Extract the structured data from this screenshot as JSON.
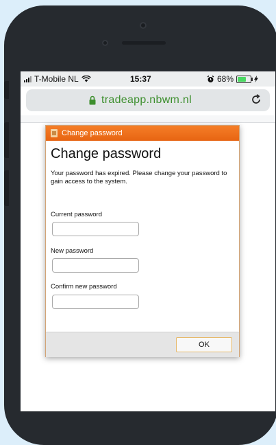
{
  "status_bar": {
    "carrier": "T-Mobile NL",
    "time": "15:37",
    "battery_percent": "68%",
    "battery_level": 0.68,
    "battery_color": "#4cd964"
  },
  "browser": {
    "url": "tradeapp.nbwm.nl",
    "url_color": "#3d8f2e",
    "icons": [
      "lock-icon",
      "reload-icon"
    ]
  },
  "dialog": {
    "window_title": "Change password",
    "heading": "Change password",
    "message": "Your password has expired. Please change your password to gain access to the system.",
    "fields": [
      {
        "label": "Current password",
        "value": "",
        "placeholder": ""
      },
      {
        "label": "New password",
        "value": "",
        "placeholder": ""
      },
      {
        "label": "Confirm new password",
        "value": "",
        "placeholder": ""
      }
    ],
    "ok_label": "OK",
    "accent_color": "#f07020"
  }
}
